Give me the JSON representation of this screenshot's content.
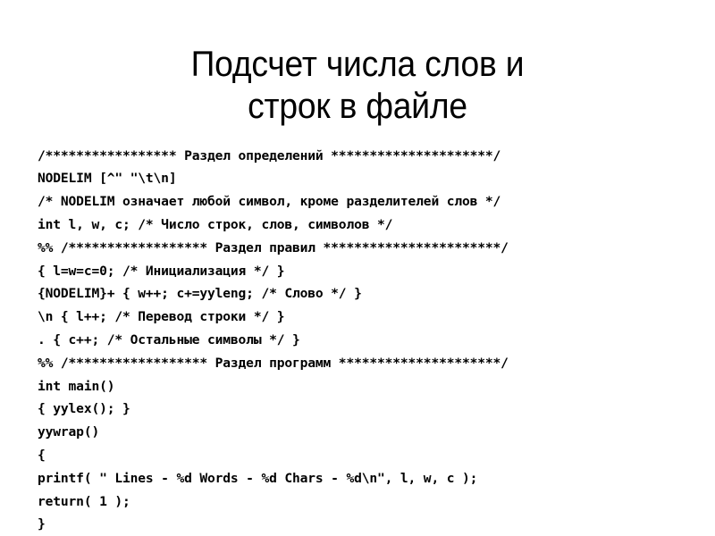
{
  "slide": {
    "title": "Подсчет числа слов и\nстрок в файле",
    "background_color": "#ffffff",
    "text_color": "#000000",
    "language": "ru"
  },
  "code": {
    "language": "lex",
    "lines": [
      "/***************** Раздел определений *********************/",
      "NODELIM [^\" \"\\t\\n]",
      "/* NODELIM означает любой символ, кроме разделителей слов */",
      "int l, w, c; /* Число строк, слов, символов */",
      "%% /****************** Раздел правил ***********************/",
      "{ l=w=c=0; /* Инициализация */ }",
      "{NODELIM}+ { w++; c+=yyleng; /* Слово */ }",
      "\\n { l++; /* Перевод строки */ }",
      ". { c++; /* Остальные символы */ }",
      "%% /****************** Раздел программ *********************/",
      "int main()",
      "{ yylex(); }",
      "yywrap()",
      "{",
      "printf( \" Lines - %d Words - %d Chars - %d\\n\", l, w, c );",
      "return( 1 );",
      "}"
    ]
  }
}
